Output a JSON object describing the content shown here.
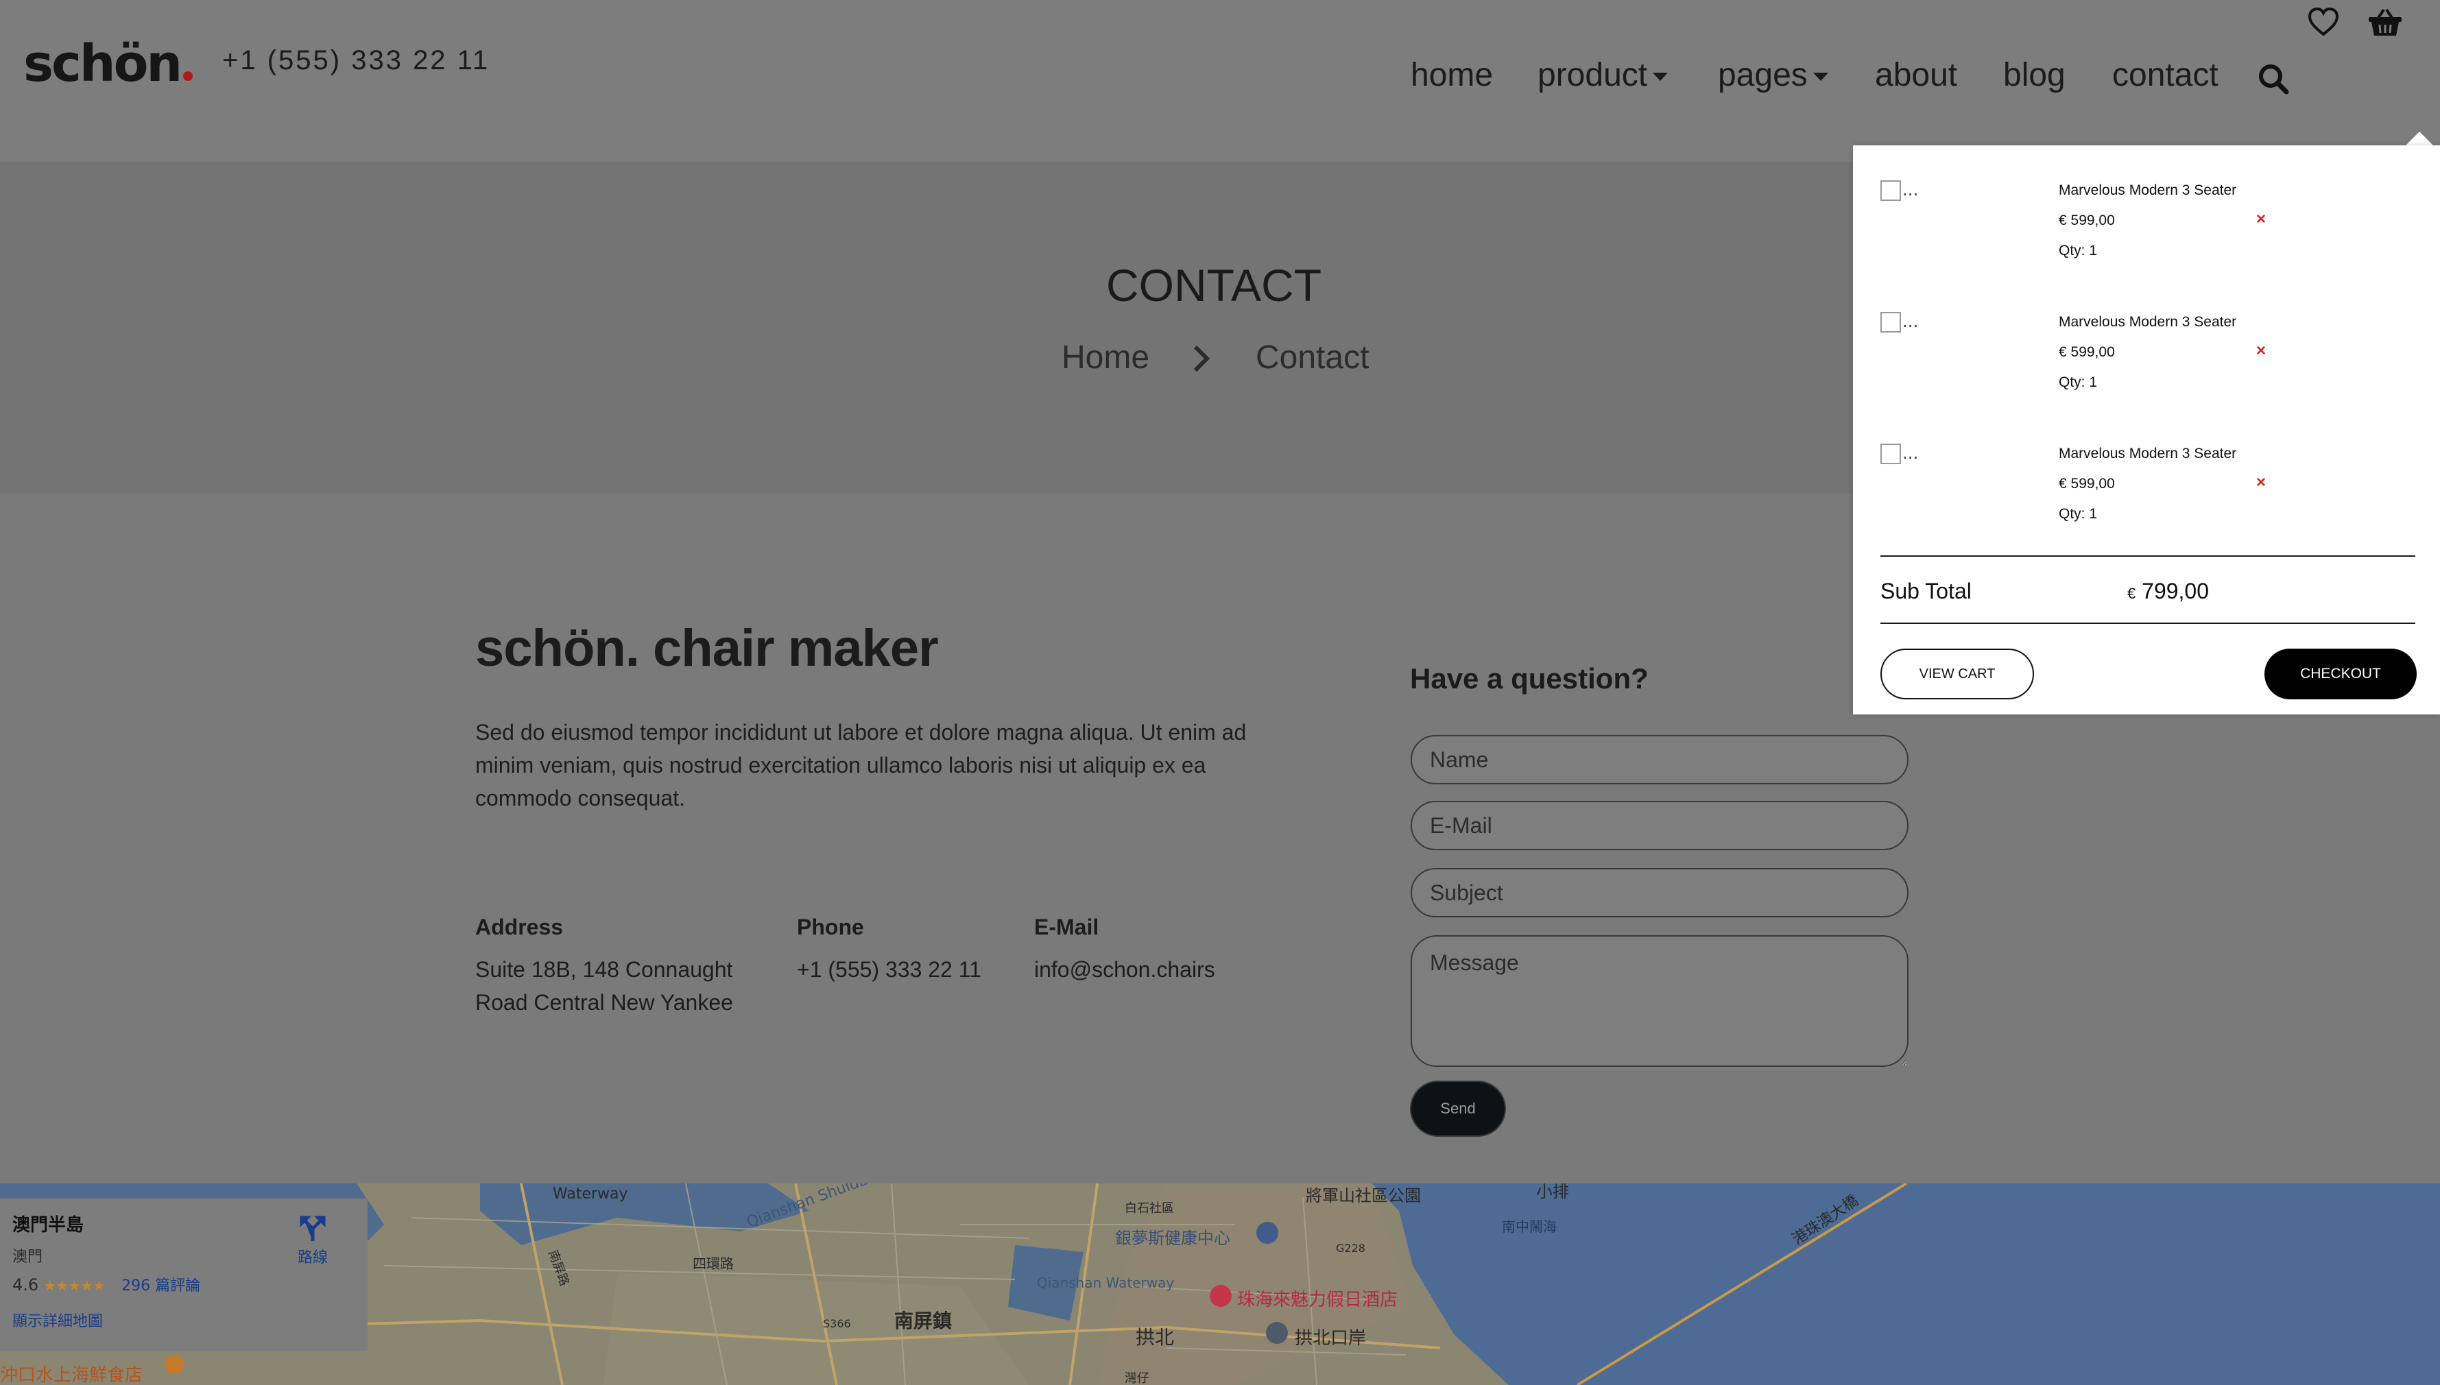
{
  "header": {
    "logo_text": "schön",
    "phone": "+1 (555) 333 22 11",
    "nav": {
      "home": "home",
      "product": "product",
      "pages": "pages",
      "about": "about",
      "blog": "blog",
      "contact": "contact"
    }
  },
  "banner": {
    "title": "CONTACT",
    "breadcrumb": {
      "home": "Home",
      "current": "Contact"
    }
  },
  "company": {
    "name": "schön. chair maker",
    "description": "Sed do eiusmod tempor incididunt ut labore et dolore magna aliqua. Ut enim ad minim veniam, quis nostrud exercitation ullamco laboris nisi ut aliquip ex ea commodo consequat.",
    "address_label": "Address",
    "address_line1": "Suite 18B, 148 Connaught",
    "address_line2": "Road Central New Yankee",
    "phone_label": "Phone",
    "phone_value": "+1 (555) 333 22 11",
    "email_label": "E-Mail",
    "email_value": "info@schon.chairs"
  },
  "form": {
    "heading": "Have a question?",
    "name_placeholder": "Name",
    "email_placeholder": "E-Mail",
    "subject_placeholder": "Subject",
    "message_placeholder": "Message",
    "send_label": "Send"
  },
  "cart": {
    "thumb_alt": "...",
    "items": [
      {
        "name": "Marvelous Modern 3 Seater",
        "price": "€ 599,00",
        "qty": "Qty: 1"
      },
      {
        "name": "Marvelous Modern 3 Seater",
        "price": "€ 599,00",
        "qty": "Qty: 1"
      },
      {
        "name": "Marvelous Modern 3 Seater",
        "price": "€ 599,00",
        "qty": "Qty: 1"
      }
    ],
    "remove_symbol": "×",
    "subtotal_label": "Sub Total",
    "subtotal_currency": "€",
    "subtotal_value": "799,00",
    "view_cart_label": "VIEW CART",
    "checkout_label": "CHECKOUT"
  },
  "map": {
    "place_title": "澳門半島",
    "place_subtitle": "澳門",
    "rating": "4.6",
    "stars": "★★★★★",
    "reviews": "296 篇評論",
    "directions_label": "路線",
    "larger_map_link": "顯示詳細地圖",
    "labels": {
      "waterway": "Waterway",
      "qianshan": "Qianshan Waterway",
      "qianshan_shuidao": "Qianshan Shuidao",
      "sihuan": "四環路",
      "nanpingzhen": "南屏鎮",
      "gongbei": "拱北",
      "gongbei_port": "拱北口岸",
      "hotel": "珠海來魅力假日酒店",
      "health": "銀夢斯健康中心",
      "park": "將軍山社區公園",
      "xiaogang": "小排",
      "nanzhongdi": "南中鬧海",
      "bridge": "港珠澳大橋",
      "g228": "G228",
      "s366": "S366",
      "wanzai": "灣仔",
      "restaurant": "沖口水上海鮮食店",
      "baishi": "白石社區",
      "nanping_road": "南屏路"
    }
  },
  "colors": {
    "cart_remove": "#d21f1f",
    "logo_dot": "#b01818",
    "checkout_bg": "#000000"
  },
  "icons": {
    "wishlist": "heart-icon",
    "cart": "basket-icon",
    "search": "search-icon",
    "breadcrumb_sep": "chevron-right-icon",
    "directions": "directions-icon"
  }
}
